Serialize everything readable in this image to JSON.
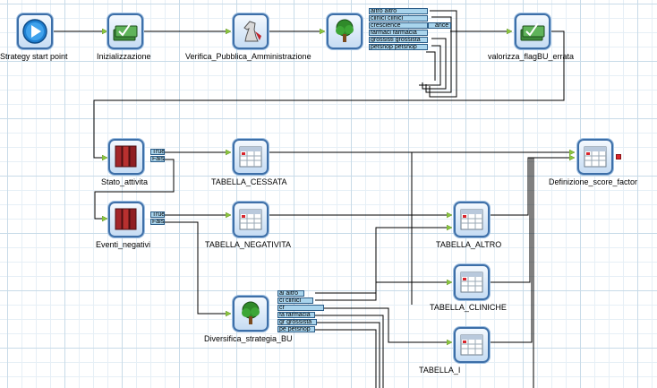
{
  "nodes": {
    "start": {
      "label": "Strategy start point",
      "icon": "play-icon"
    },
    "init": {
      "label": "Inizializzazione",
      "icon": "money-stack-icon"
    },
    "verifica": {
      "label": "Verifica_Pubblica_Amministrazione",
      "icon": "chess-knight-icon"
    },
    "tree1": {
      "label": "",
      "icon": "tree-icon"
    },
    "valorizza": {
      "label": "valorizza_flagBU_errata",
      "icon": "money-stack-icon"
    },
    "stato": {
      "label": "Stato_attivita",
      "icon": "books-icon"
    },
    "cessata": {
      "label": "TABELLA_CESSATA",
      "icon": "table-icon"
    },
    "definizione": {
      "label": "Definizione_score_factor",
      "icon": "table-icon"
    },
    "eventi": {
      "label": "Eventi_negativi",
      "icon": "books-icon"
    },
    "negativita": {
      "label": "TABELLA_NEGATIVITA",
      "icon": "table-icon"
    },
    "altro": {
      "label": "TABELLA_ALTRO",
      "icon": "table-icon"
    },
    "cliniche": {
      "label": "TABELLA_CLINICHE",
      "icon": "table-icon"
    },
    "diversifica": {
      "label": "Diversifica_strategia_BU",
      "icon": "tree-icon"
    },
    "tab_f": {
      "label": "TABELLA_I",
      "icon": "table-icon"
    }
  },
  "ports": {
    "tree1": [
      "altro altro",
      "clinici clinici",
      "crescience",
      "farmaci farmacia",
      "grossisti grossista",
      "petshop petshop"
    ],
    "tree1_extra": "ance",
    "stato": [
      "True",
      "False"
    ],
    "eventi": [
      "True",
      "False"
    ],
    "diversifica": [
      "al altro",
      "cl clinici",
      "cr",
      "fa farmacia",
      "gr grossista",
      "pe petshop"
    ]
  },
  "colors": {
    "node_border": "#3d6fa8",
    "port_fill": "#a9d4ec",
    "wire": "#000000",
    "arrow": "#8cc63f",
    "output_port": "#d9252c"
  }
}
